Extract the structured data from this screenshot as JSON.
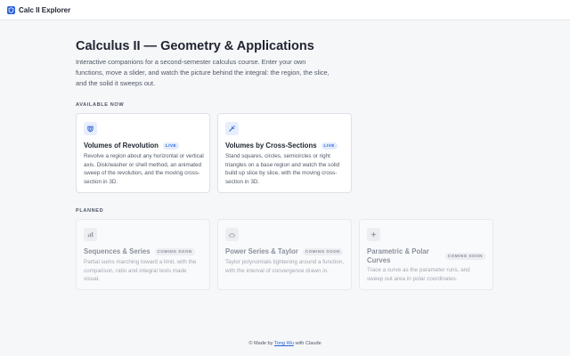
{
  "app": {
    "title": "Calc II Explorer",
    "logo_icon": "shield-icon",
    "accent": "#2d63d8"
  },
  "page": {
    "title": "Calculus II — Geometry & Applications",
    "intro": "Interactive companions for a second-semester calculus course. Enter your own functions, move a slider, and watch the picture behind the integral: the region, the slice, and the solid it sweeps out."
  },
  "sections": {
    "available": "AVAILABLE NOW",
    "planned": "PLANNED"
  },
  "available_cards": [
    {
      "icon": "solid-of-revolution-icon",
      "title": "Volumes of Revolution",
      "badge": "LIVE",
      "desc": "Revolve a region about any horizontal or vertical axis. Disk/washer or shell method, an animated sweep of the revolution, and the moving cross-section in 3D."
    },
    {
      "icon": "cross-section-icon",
      "title": "Volumes by Cross-Sections",
      "badge": "LIVE",
      "desc": "Stand squares, circles, semicircles or right triangles on a base region and watch the solid build up slice by slice, with the moving cross-section in 3D."
    }
  ],
  "planned_cards": [
    {
      "icon": "bar-chart-icon",
      "title": "Sequences & Series",
      "badge": "COMING SOON",
      "desc": "Partial sums marching toward a limit, with the comparison, ratio and integral tests made visual."
    },
    {
      "icon": "curve-icon",
      "title": "Power Series & Taylor",
      "badge": "COMING SOON",
      "desc": "Taylor polynomials tightening around a function, with the interval of convergence drawn in."
    },
    {
      "icon": "sparkle-icon",
      "title": "Parametric & Polar Curves",
      "badge": "COMING SOON",
      "desc": "Trace a curve as the parameter runs, and sweep out area in polar coordinates."
    }
  ],
  "footer": {
    "prefix": "© Made by",
    "author": "Tong Wu",
    "suffix": "with Claude"
  }
}
